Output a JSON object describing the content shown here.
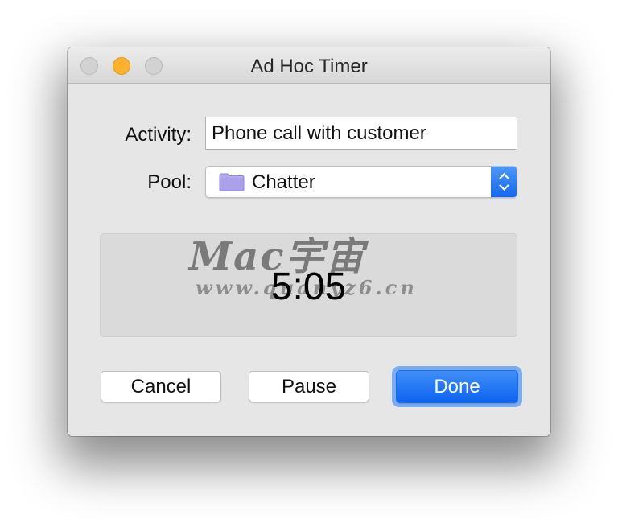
{
  "window": {
    "title": "Ad Hoc Timer",
    "controls": [
      "close",
      "minimize",
      "zoom"
    ]
  },
  "form": {
    "activity_label": "Activity:",
    "activity_value": "Phone call with customer",
    "pool_label": "Pool:",
    "pool_selected": "Chatter",
    "pool_icon": "folder-icon"
  },
  "timer": {
    "value": "5:05"
  },
  "watermark": {
    "line1": "Mac宇宙",
    "line2": "www.quanyz6.cn"
  },
  "buttons": {
    "cancel": "Cancel",
    "pause": "Pause",
    "done": "Done"
  },
  "colors": {
    "accent": "#1a6cea",
    "minimize": "#fcb22d",
    "window_bg": "#e6e6e6"
  }
}
